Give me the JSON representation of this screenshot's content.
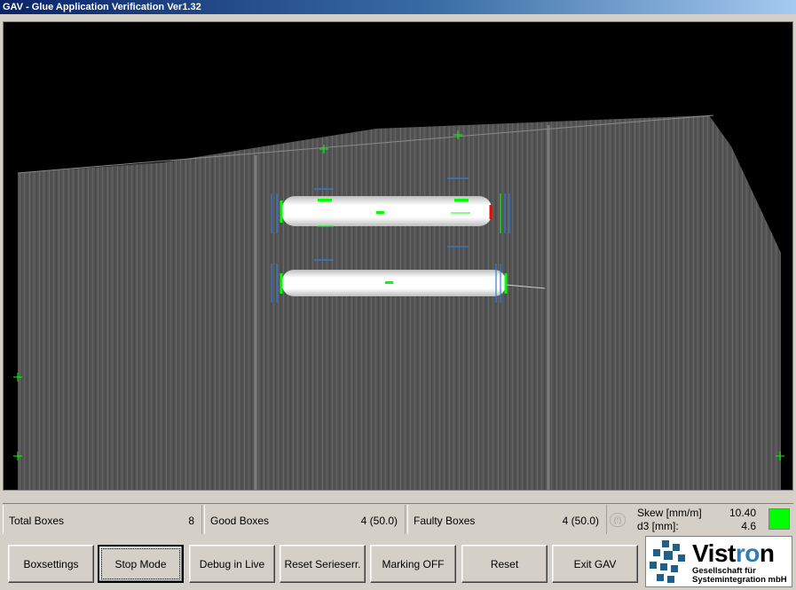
{
  "window": {
    "title": "GAV - Glue Application Verification Ver1.32"
  },
  "viewport": {
    "content": "camera-image",
    "marker_color": "#00ff00",
    "guide_color": "#2f7fe0",
    "fault_color": "#ff0000"
  },
  "status": {
    "total_label": "Total Boxes",
    "total_value": "8",
    "good_label": "Good Boxes",
    "good_value": "4 (50.0)",
    "faulty_label": "Faulty Boxes",
    "faulty_value": "4 (50.0)",
    "indicator": "(!)",
    "skew_label": "Skew [mm/m]",
    "skew_value": "10.40",
    "d3_label": "d3 [mm]:",
    "d3_value": "4.6",
    "ok_color": "#00ff00"
  },
  "buttons": {
    "boxsettings": "Boxsettings",
    "stop_mode": "Stop Mode",
    "debug_live": "Debug in Live",
    "reset_serie": "Reset Serieserr.",
    "marking": "Marking OFF",
    "reset": "Reset",
    "exit": "Exit GAV"
  },
  "logo": {
    "name_start": "Vist",
    "name_accent": "ro",
    "name_end": "n",
    "line1": "Gesellschaft für",
    "line2": "Systemintegration mbH",
    "accent_color": "#2f7fb6"
  }
}
